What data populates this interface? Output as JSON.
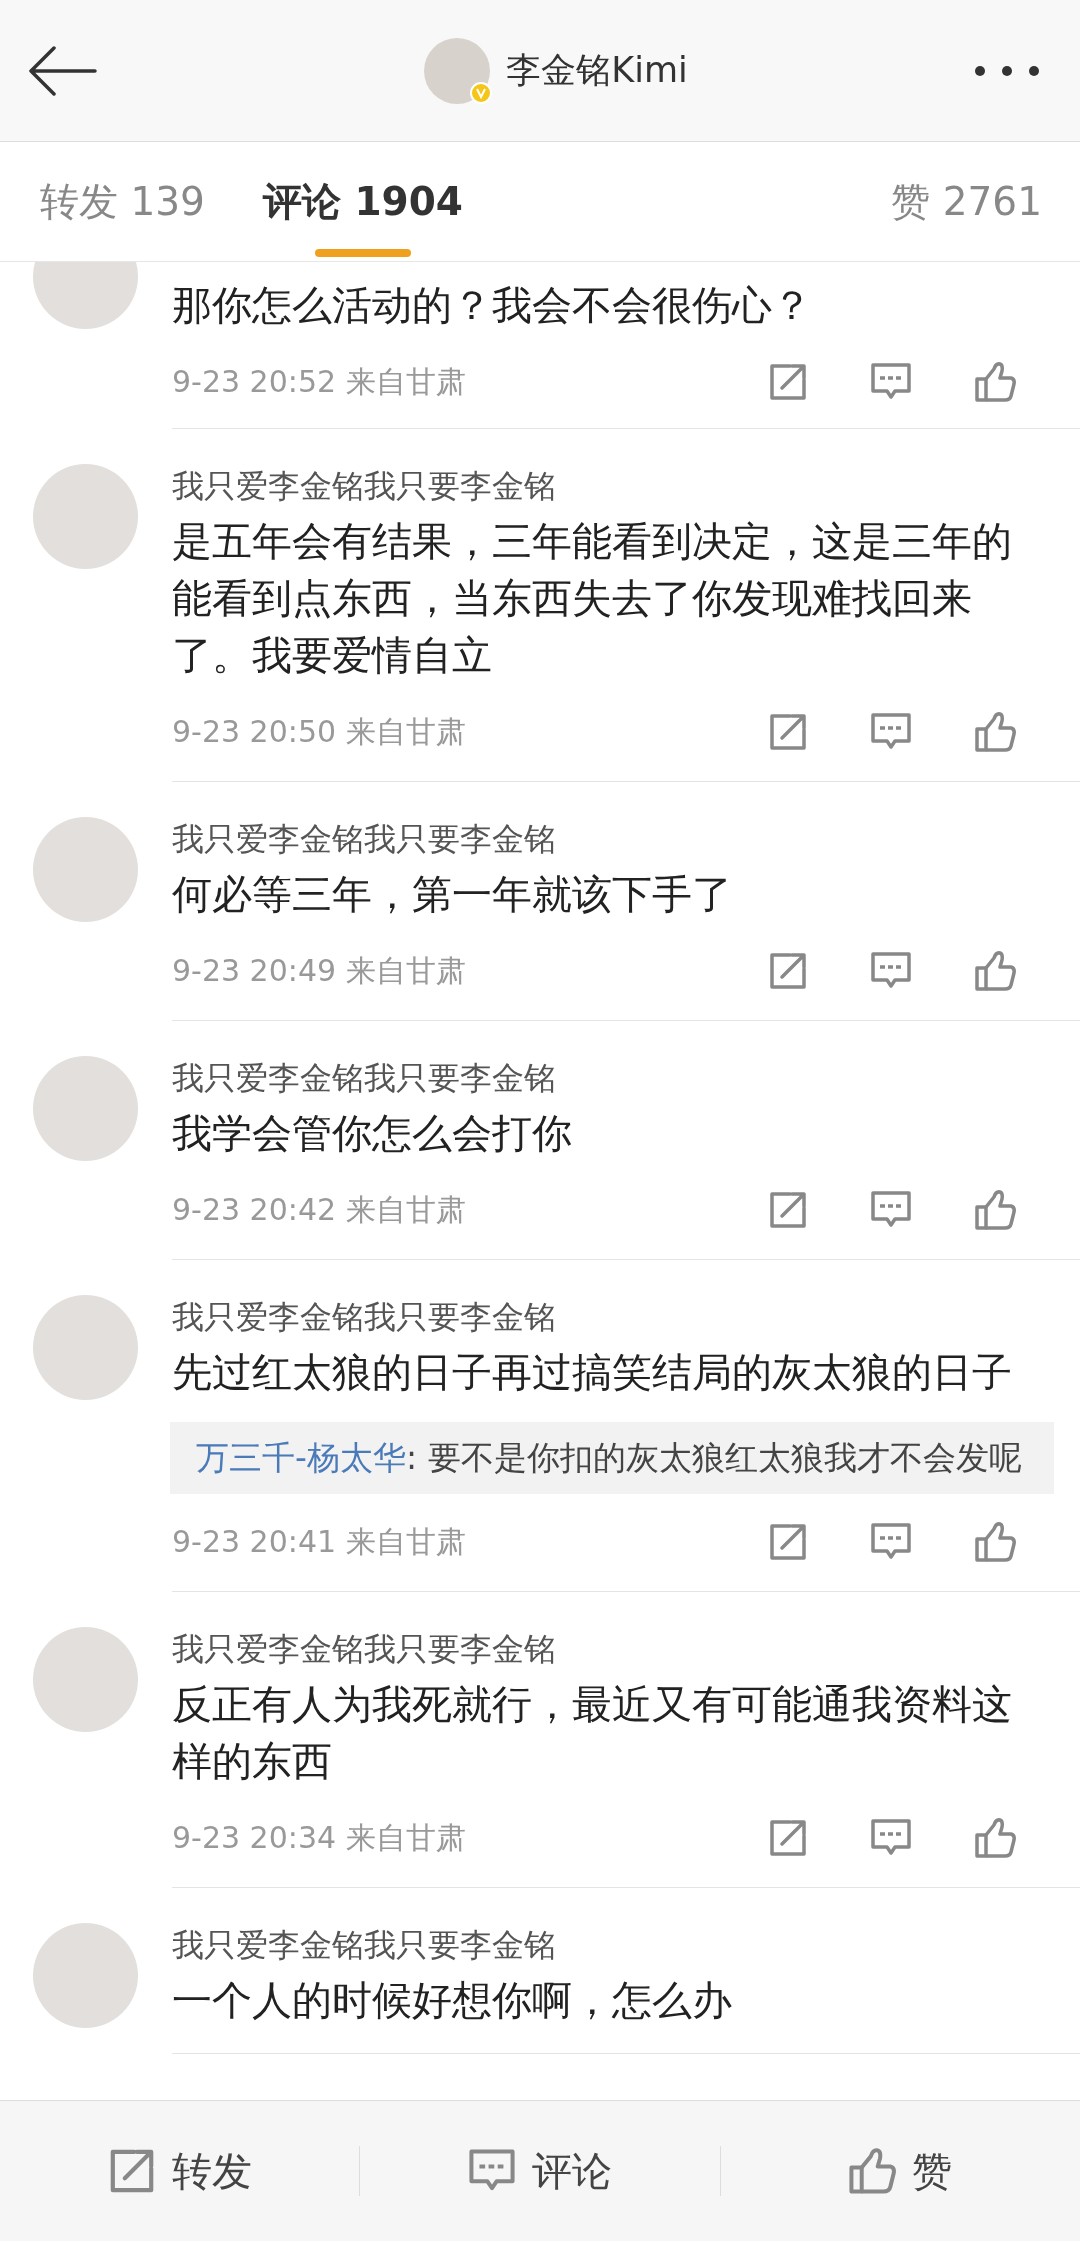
{
  "header": {
    "title": "李金铭Kimi",
    "verified": true
  },
  "tabs": [
    {
      "label": "转发 139",
      "selected": false
    },
    {
      "label": "评论 1904",
      "selected": true
    },
    {
      "label": "赞 2761",
      "selected": false
    }
  ],
  "comments": [
    {
      "text": "那你怎么活动的？我会不会很伤心？",
      "time": "9-23 20:52 来自甘肃"
    },
    {
      "author": "我只爱李金铭我只要李金铭",
      "text": "是五年会有结果，三年能看到决定，这是三年的能看到点东西，当东西失去了你发现难找回来了。我要爱情自立",
      "time": "9-23 20:50 来自甘肃"
    },
    {
      "author": "我只爱李金铭我只要李金铭",
      "text": "何必等三年，第一年就该下手了",
      "time": "9-23 20:49 来自甘肃"
    },
    {
      "author": "我只爱李金铭我只要李金铭",
      "text": "我学会管你怎么会打你",
      "time": "9-23 20:42 来自甘肃"
    },
    {
      "author": "我只爱李金铭我只要李金铭",
      "text": "先过红太狼的日子再过搞笑结局的灰太狼的日子",
      "reply": {
        "author": "万三千-杨太华",
        "text": ": 要不是你扣的灰太狼红太狼我才不会发呢"
      },
      "time": "9-23 20:41 来自甘肃"
    },
    {
      "author": "我只爱李金铭我只要李金铭",
      "text": "反正有人为我死就行，最近又有可能通我资料这样的东西",
      "time": "9-23 20:34 来自甘肃"
    },
    {
      "author": "我只爱李金铭我只要李金铭",
      "text": "一个人的时候好想你啊，怎么办"
    }
  ],
  "bottom_bar": [
    {
      "kind": "repost",
      "label": "转发"
    },
    {
      "kind": "comment",
      "label": "评论"
    },
    {
      "kind": "like",
      "label": "赞"
    }
  ]
}
